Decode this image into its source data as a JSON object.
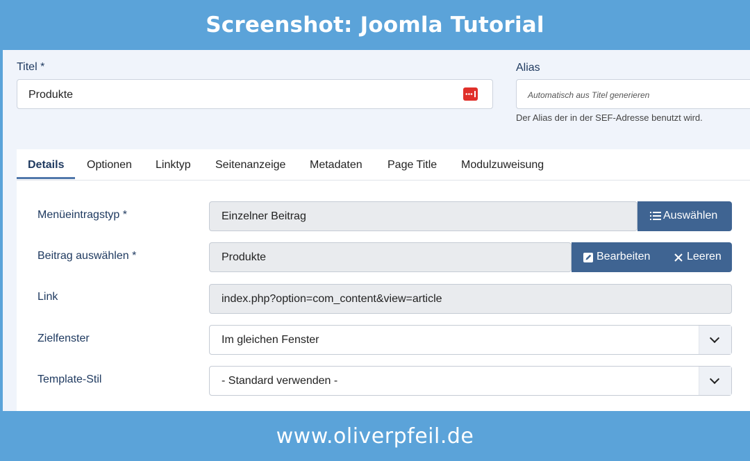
{
  "banner": {
    "title": "Screenshot: Joomla Tutorial"
  },
  "footer": {
    "url": "www.oliverpfeil.de"
  },
  "form": {
    "title_label": "Titel *",
    "title_value": "Produkte",
    "alias_label": "Alias",
    "alias_placeholder": "Automatisch aus Titel generieren",
    "alias_help": "Der Alias der in der SEF-Adresse benutzt wird."
  },
  "tabs": [
    {
      "label": "Details",
      "active": true
    },
    {
      "label": "Optionen"
    },
    {
      "label": "Linktyp"
    },
    {
      "label": "Seitenanzeige"
    },
    {
      "label": "Metadaten"
    },
    {
      "label": "Page Title"
    },
    {
      "label": "Modulzuweisung"
    }
  ],
  "details": {
    "menu_item_type": {
      "label": "Menüeintragstyp *",
      "value": "Einzelner Beitrag",
      "select_button": "Auswählen"
    },
    "select_article": {
      "label": "Beitrag auswählen *",
      "value": "Produkte",
      "edit_button": "Bearbeiten",
      "clear_button": "Leeren"
    },
    "link": {
      "label": "Link",
      "value": "index.php?option=com_content&view=article"
    },
    "target_window": {
      "label": "Zielfenster",
      "value": "Im gleichen Fenster"
    },
    "template_style": {
      "label": "Template-Stil",
      "value": "- Standard verwenden -"
    }
  },
  "icons": {
    "password": "password-dots-icon",
    "list": "list-icon",
    "edit": "edit-icon",
    "clear": "close-icon",
    "dropdown": "chevron-down-icon"
  },
  "colors": {
    "banner": "#5ba3d9",
    "button": "#3f6492",
    "label": "#1f3a60",
    "password_icon": "#e0302a",
    "active_tab_underline": "#5178ab"
  }
}
